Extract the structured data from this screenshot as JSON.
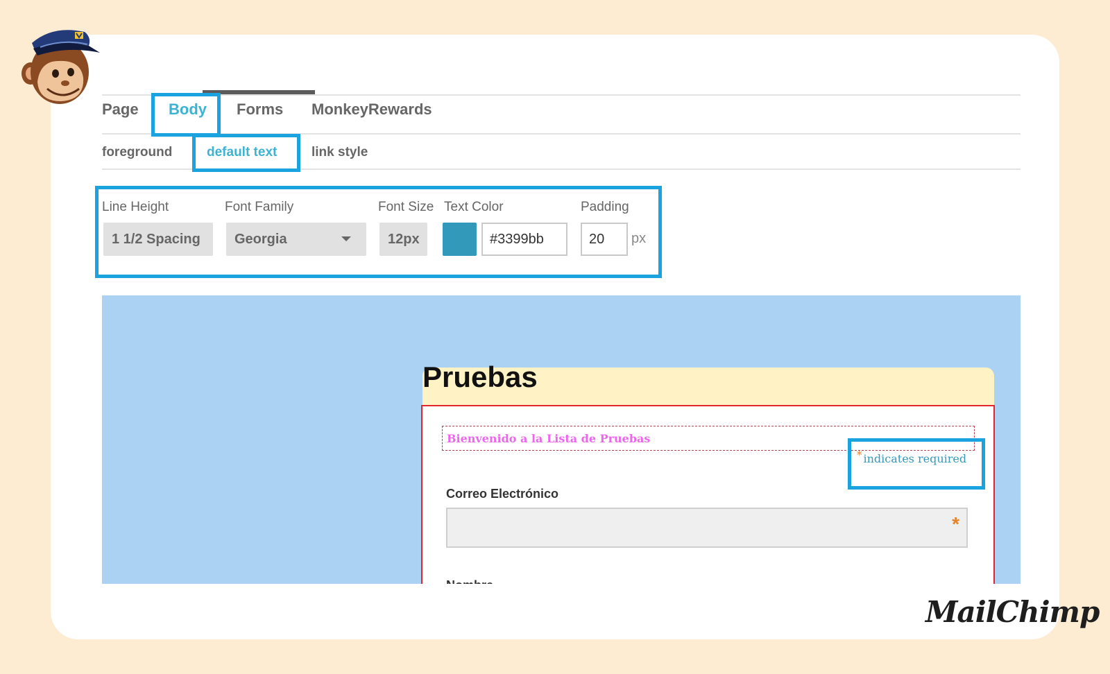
{
  "tabs": [
    "Page",
    "Body",
    "Forms",
    "MonkeyRewards"
  ],
  "active_tab": "Body",
  "subtabs": [
    "foreground",
    "default text",
    "link style"
  ],
  "active_subtab": "default text",
  "settings": {
    "line_height": {
      "label": "Line Height",
      "value": "1 1/2 Spacing"
    },
    "font_family": {
      "label": "Font Family",
      "value": "Georgia"
    },
    "font_size": {
      "label": "Font Size",
      "value": "12px"
    },
    "text_color": {
      "label": "Text Color",
      "value": "#3399bb",
      "swatch": "#3399bb"
    },
    "padding": {
      "label": "Padding",
      "value": "20",
      "unit": "px"
    }
  },
  "preview": {
    "form_title": "Pruebas",
    "welcome_text": "Bienvenido a la Lista de Pruebas",
    "required_star": "*",
    "required_note": "indicates required",
    "field_label": "Correo Electrónico",
    "field_required_star": "*",
    "next_field_label": "Nombre"
  },
  "brand": "MailChimp",
  "colors": {
    "highlight": "#1aa3de",
    "active_tab": "#3db3d3",
    "preview_background": "#abd1f3",
    "form_header": "#fff2c4",
    "form_border": "#e0262b",
    "welcome_text": "#ee66ee",
    "required_star": "#e5822a"
  },
  "icons": {
    "mascot": "freddie-chimp-icon",
    "dropdown": "chevron-down-icon"
  }
}
